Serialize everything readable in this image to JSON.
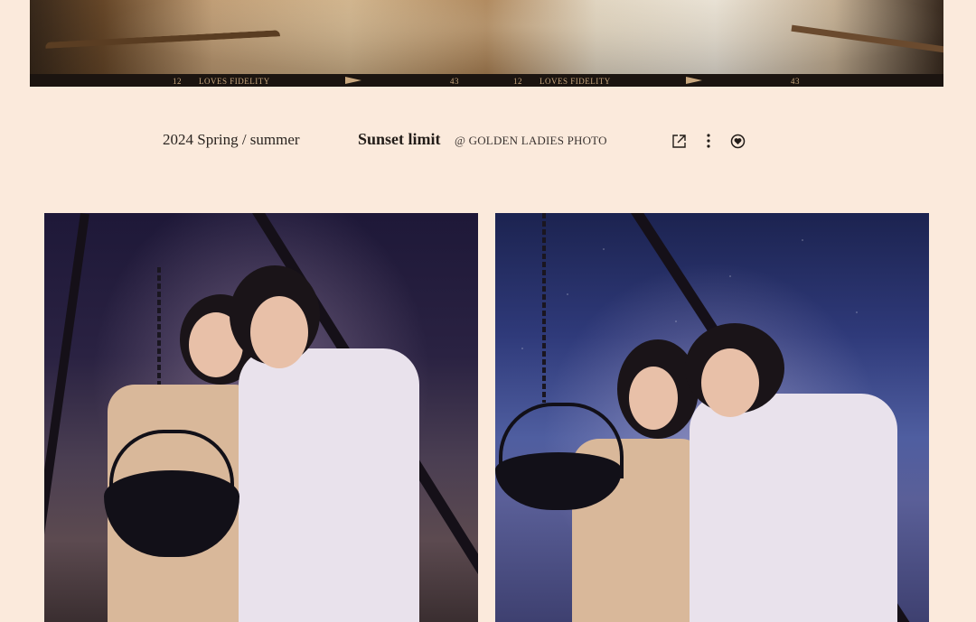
{
  "top_photo": {
    "film_strip": {
      "labels": [
        {
          "number": "12",
          "brand": "LOVES FIDELITY",
          "frame": "43"
        },
        {
          "number": "12",
          "brand": "LOVES FIDELITY",
          "frame": "43"
        }
      ]
    }
  },
  "caption": {
    "season": "2024 Spring / summer",
    "title": "Sunset limit",
    "credit": "@ GOLDEN LADIES PHOTO"
  },
  "actions": {
    "share_icon": "share-icon",
    "more_icon": "more-vertical-icon",
    "favorite_icon": "heart-icon"
  },
  "photos": [
    {
      "name": "photo-couple-campfire-dusk",
      "palette": "deep purple"
    },
    {
      "name": "photo-couple-campfire-starry-sky",
      "palette": "blue night"
    }
  ],
  "colors": {
    "background": "#fbeadc",
    "text": "#221c18",
    "film_label": "#c9a77e"
  }
}
